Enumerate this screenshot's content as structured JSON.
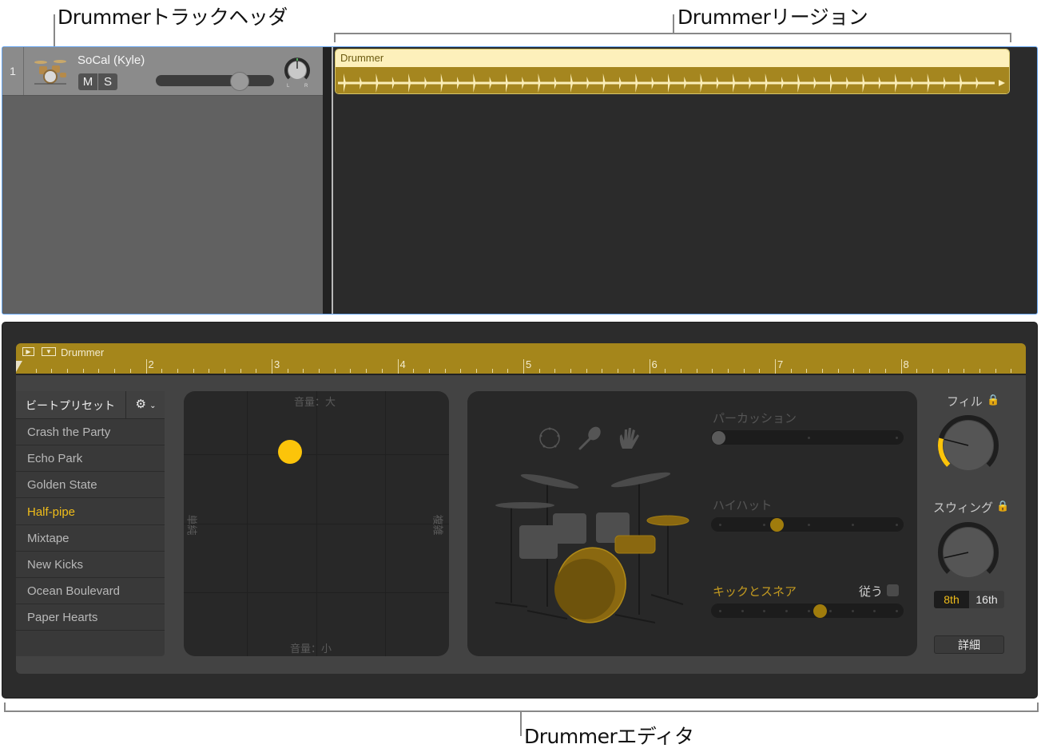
{
  "callouts": {
    "track_header": "Drummerトラックヘッダ",
    "region": "Drummerリージョン",
    "editor": "Drummerエディタ"
  },
  "track": {
    "number": "1",
    "name": "SoCal (Kyle)",
    "mute_label": "M",
    "solo_label": "S",
    "volume": 0.72,
    "pan_left": "L",
    "pan_right": "R",
    "icon": "drum-kit-icon"
  },
  "region": {
    "title": "Drummer"
  },
  "editor": {
    "title": "Drummer",
    "ruler_bars": [
      "2",
      "3",
      "4",
      "5",
      "6",
      "7",
      "8"
    ],
    "presets": {
      "header": "ビートプリセット",
      "gear": "gear-icon",
      "items": [
        "Crash the Party",
        "Echo Park",
        "Golden State",
        "Half-pipe",
        "Mixtape",
        "New Kicks",
        "Ocean Boulevard",
        "Paper Hearts"
      ],
      "selected": "Half-pipe"
    },
    "xy_pad": {
      "top": "音量：大",
      "bottom": "音量：小",
      "left": "単純",
      "right": "複雑",
      "complexity": 0.4,
      "loudness": 0.77
    },
    "kit": {
      "percussion_label": "パーカッション",
      "percussion_value": 0,
      "hihat_label": "ハイハット",
      "hihat_value": 0.33,
      "kick_snare_label": "キックとスネア",
      "kick_snare_value": 0.57,
      "follow_label": "従う",
      "percussion_icons": [
        "tambourine-icon",
        "shaker-icon",
        "clap-icon"
      ]
    },
    "fill": {
      "label": "フィル",
      "value": 0.22
    },
    "swing": {
      "label": "スウィング",
      "value": 0.12
    },
    "swing_modes": [
      "8th",
      "16th"
    ],
    "swing_selected": "8th",
    "details_label": "詳細"
  },
  "colors": {
    "accent": "#fcc40a",
    "region_head": "#fdf0bb",
    "region_body": "#a5861f",
    "selection_border": "#69a7f0"
  }
}
